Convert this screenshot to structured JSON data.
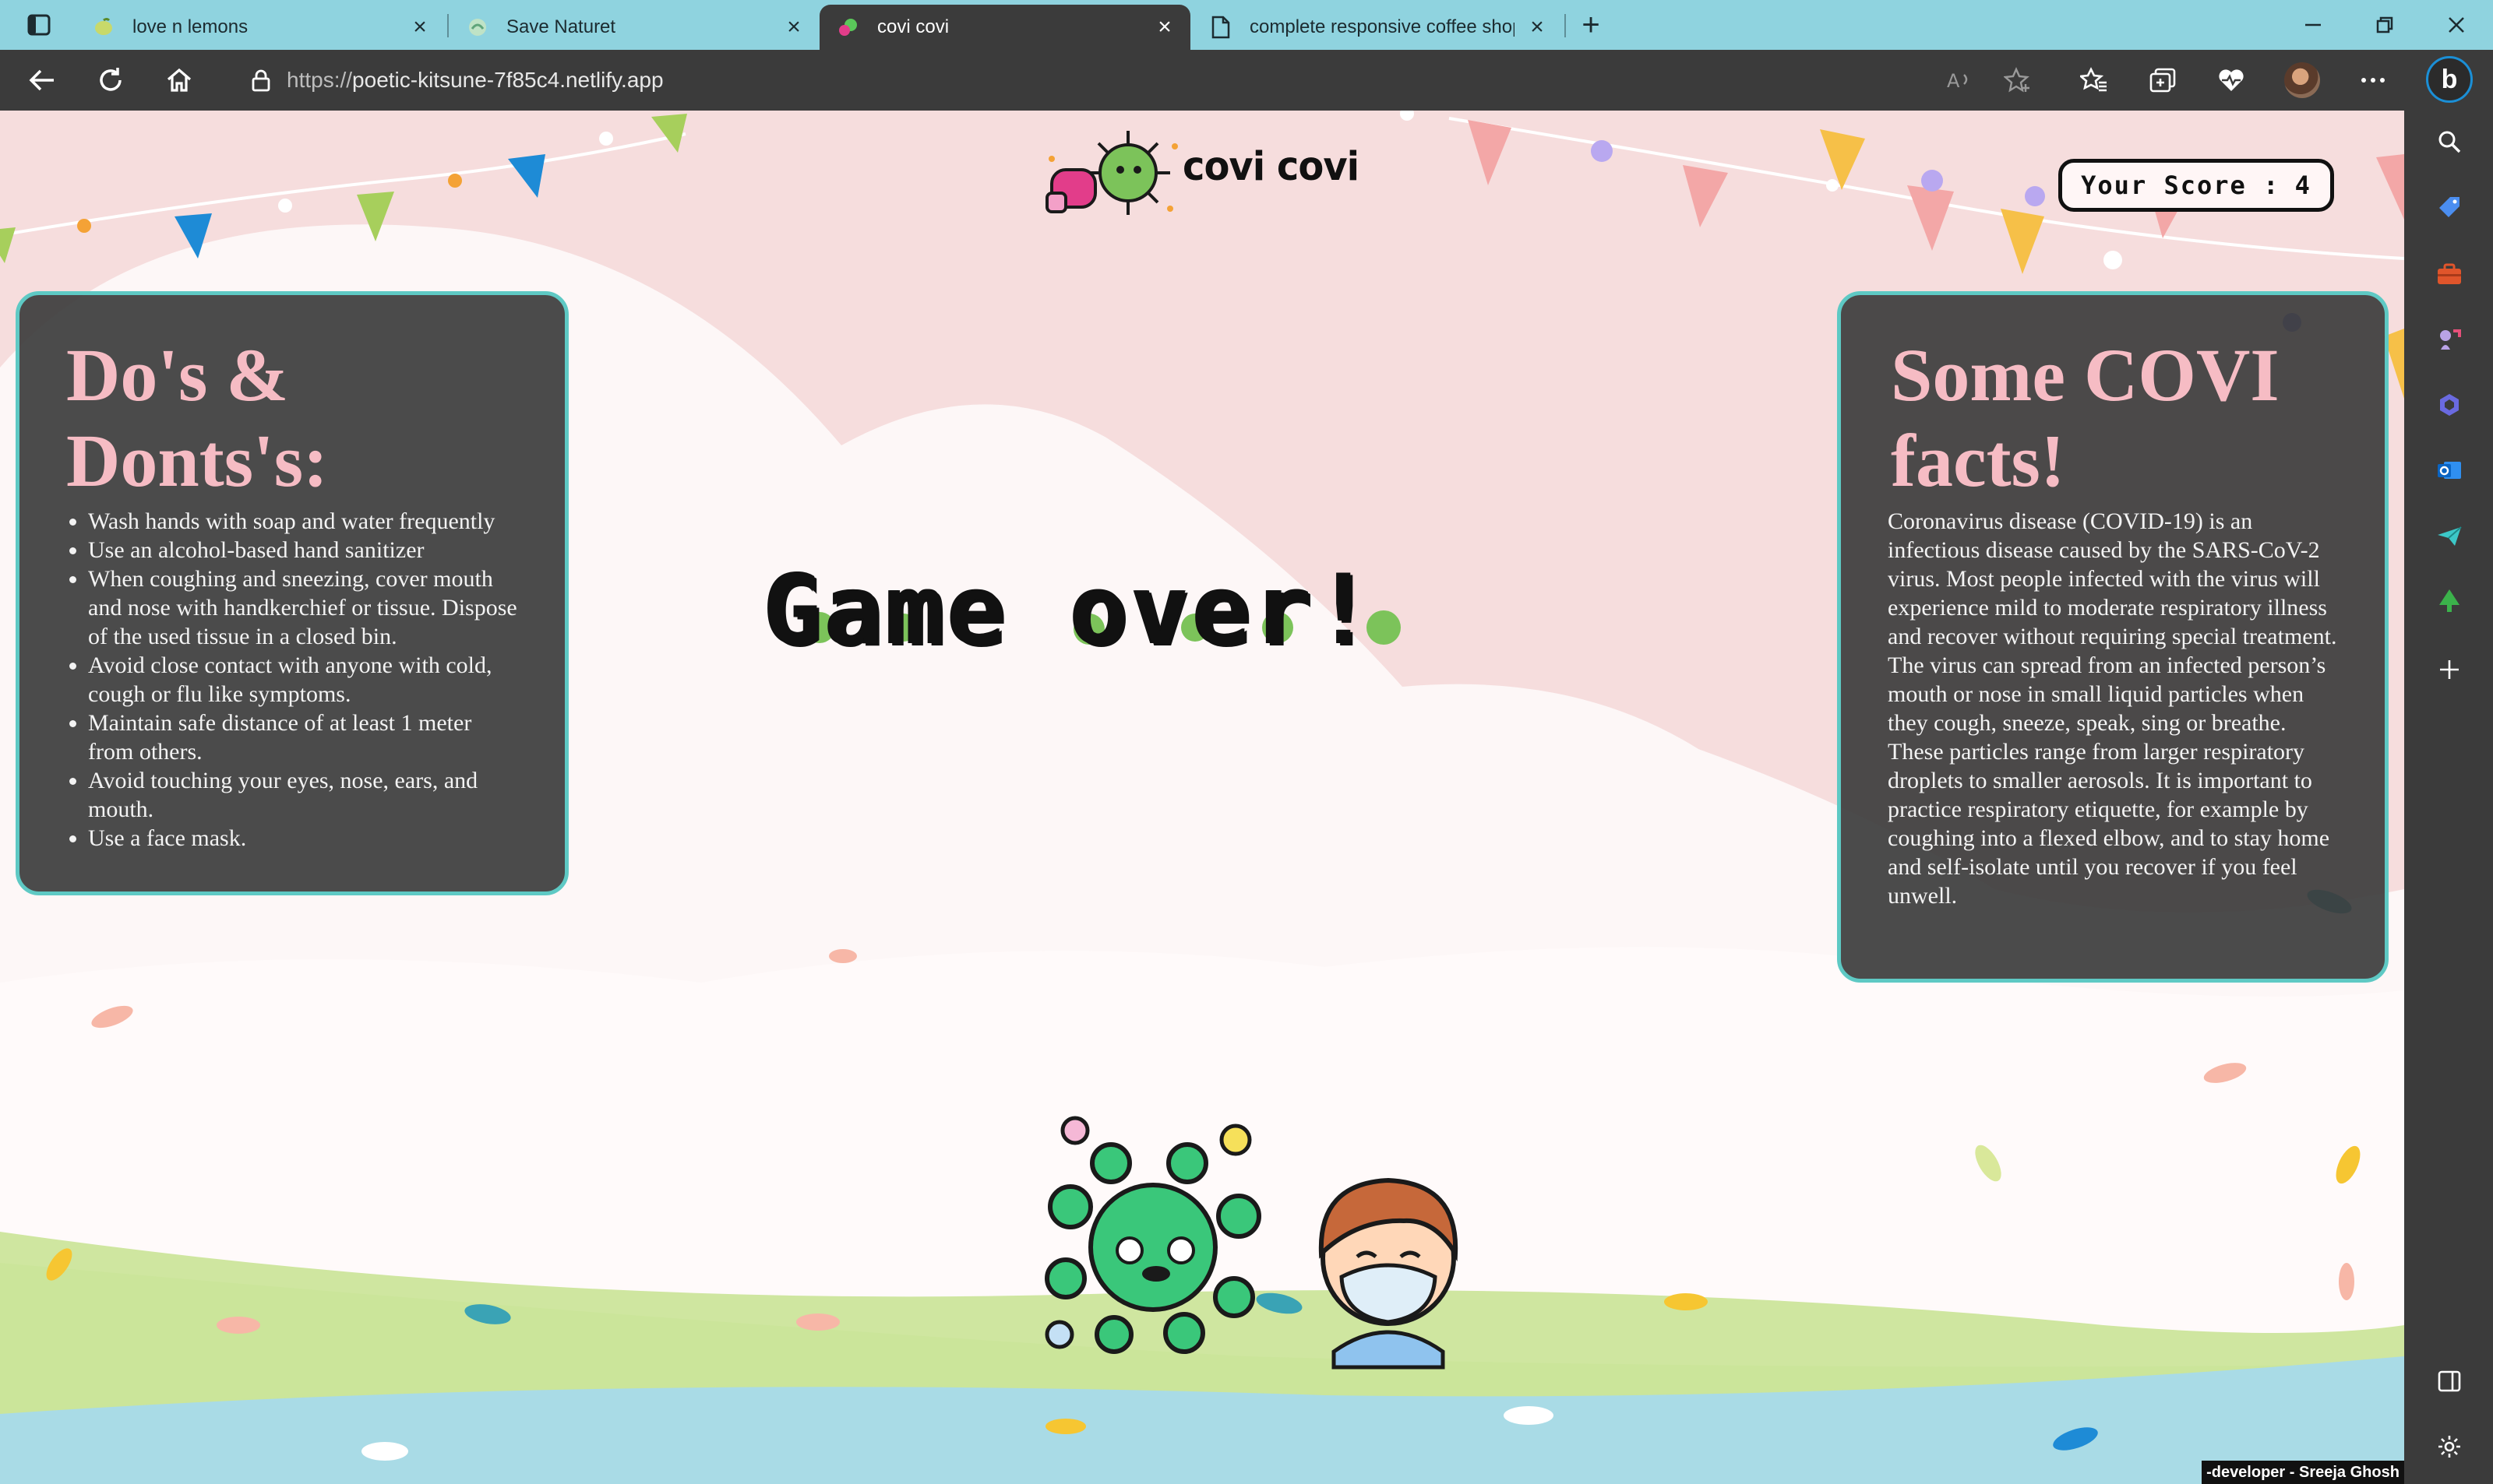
{
  "browser": {
    "tabs": [
      {
        "title": "love n lemons",
        "active": false
      },
      {
        "title": "Save Naturet",
        "active": false
      },
      {
        "title": "covi covi",
        "active": true
      },
      {
        "title": "complete responsive coffee shop",
        "active": false
      }
    ],
    "url": {
      "scheme": "https://",
      "host": "poetic-kitsune-7f85c4.netlify.app"
    },
    "icons": {
      "sidebar_toggle": "tab-actions-icon",
      "back": "back-arrow-icon",
      "reload": "reload-icon",
      "home": "home-icon",
      "lock": "lock-icon",
      "read_aloud": "read-aloud-icon",
      "add_favorite": "add-favorite-icon",
      "favorites": "favorites-icon",
      "collections": "collections-icon",
      "health": "browser-essentials-icon",
      "more": "more-icon",
      "bing": "bing-copilot-icon"
    },
    "sidebar_icons": [
      "search-icon",
      "shopping-tag-icon",
      "tools-icon",
      "games-icon",
      "copilot-icon",
      "outlook-icon",
      "send-icon",
      "tree-icon",
      "add-icon",
      "split-screen-icon",
      "settings-icon"
    ],
    "colors": {
      "tab_strip": "#8fd3df",
      "toolbar": "#3b3b3b"
    }
  },
  "game": {
    "logo_text": "covi covi",
    "score_label": "Your Score :",
    "score_value": "4",
    "status": "Game over!",
    "dos_title": "Do's & Donts's:",
    "dos": [
      "Wash hands with soap and water frequently",
      "Use an alcohol-based hand sanitizer",
      "When coughing and sneezing, cover mouth and nose with handkerchief or tissue. Dispose of the used tissue in a closed bin.",
      "Avoid close contact with anyone with cold, cough or flu like symptoms.",
      "Maintain safe distance of at least 1 meter from others.",
      "Avoid touching your eyes, nose, ears, and mouth.",
      "Use a face mask."
    ],
    "facts_title": "Some COVI facts!",
    "facts_text": "Coronavirus disease (COVID-19) is an infectious disease caused by the SARS-CoV-2 virus. Most people infected with the virus will experience mild to moderate respiratory illness and recover without requiring special treatment. The virus can spread from an infected person’s mouth or nose in small liquid particles when they cough, sneeze, speak, sing or breathe. These particles range from larger respiratory droplets to smaller aerosols. It is important to practice respiratory etiquette, for example by coughing into a flexed elbow, and to stay home and self-isolate until you recover if you feel unwell.",
    "footer": "-developer - Sreeja Ghosh",
    "colors": {
      "panel_border": "#5ec9c4",
      "panel_heading": "#f6bcc4",
      "background_pink": "#f6dddd",
      "grass": "#cfe6a0",
      "water": "#a9dbe6",
      "virus": "#3ac77a"
    }
  }
}
